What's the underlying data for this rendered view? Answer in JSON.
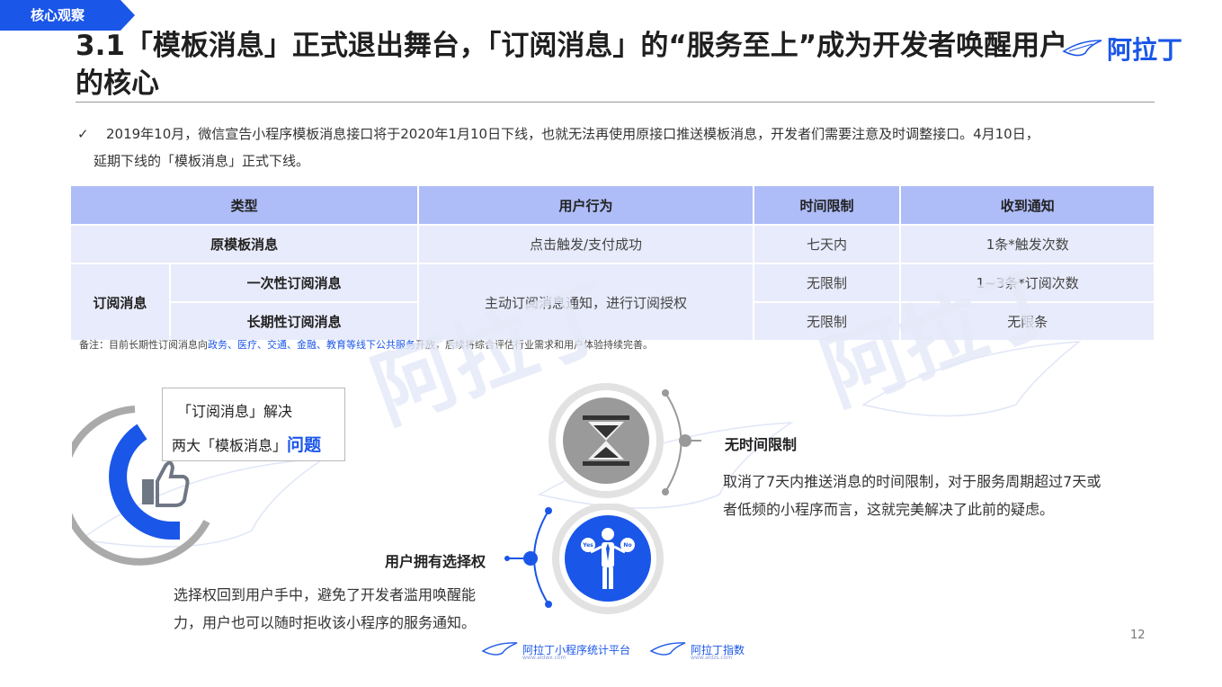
{
  "tag": "核心观察",
  "title": "3.1「模板消息」正式退出舞台，「订阅消息」的“服务至上”成为开发者唤醒用户的核心",
  "brand": "阿拉丁",
  "bullet": {
    "line1": "2019年10月，微信宣告小程序模板消息接口将于2020年1月10日下线，也就无法再使用原接口推送模板消息，开发者们需要注意及时调整接口。4月10日，",
    "line2": "延期下线的「模板消息」正式下线。"
  },
  "table": {
    "headers": [
      "类型",
      "用户行为",
      "时间限制",
      "收到通知"
    ],
    "row1": {
      "type": "原模板消息",
      "behavior": "点击触发/支付成功",
      "time": "七天内",
      "notify": "1条*触发次数"
    },
    "group": "订阅消息",
    "row2": {
      "sub": "一次性订阅消息",
      "time": "无限制",
      "notify": "1~3条*订阅次数"
    },
    "merged_behavior": "主动订阅消息通知，进行订阅授权",
    "row3": {
      "sub": "长期性订阅消息",
      "time": "无限制",
      "notify": "无限条"
    }
  },
  "note": {
    "prefix": "备注：目前长期性订阅消息向",
    "highlight": "政务、医疗、交通、金融、教育等线下公共服务",
    "suffix": "开放，后续将综合评估行业需求和用户体验持续完善。"
  },
  "callout": {
    "line1": "「订阅消息」解决",
    "line2_prefix": "两大「模板消息」",
    "line2_big": "问题"
  },
  "point1": {
    "label": "无时间限制",
    "text1": "取消了7天内推送消息的时间限制，对于服务周期超过7天或",
    "text2": "者低频的小程序而言，这就完美解决了此前的疑虑。"
  },
  "point2": {
    "label": "用户拥有选择权",
    "text1": "选择权回到用户手中，避免了开发者滥用唤醒能",
    "text2": "力，用户也可以随时拒收该小程序的服务通知。"
  },
  "yes_label": "Yes",
  "no_label": "No",
  "page_number": "12",
  "footer": {
    "left": "阿拉丁小程序统计平台",
    "left_sub": "www.aldwx.com",
    "right": "阿拉丁指数",
    "right_sub": "www.aldzs.com"
  },
  "colors": {
    "accent": "#1a56e8",
    "header_fill": "#aebcf7",
    "row_fill": "#e8ebfb",
    "gray_icon": "#9a9a9a"
  }
}
